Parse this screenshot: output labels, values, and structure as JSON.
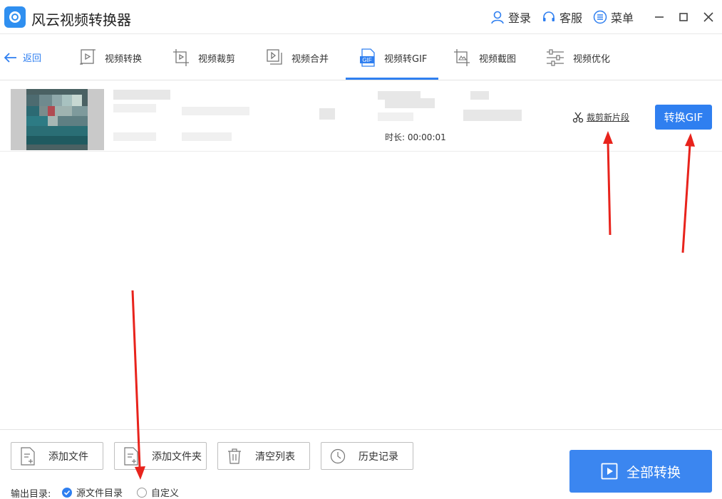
{
  "app": {
    "title": "风云视频转换器",
    "login": "登录",
    "service": "客服",
    "menu": "菜单"
  },
  "nav": {
    "back": "返回",
    "tabs": [
      {
        "label": "视频转换",
        "icon": "video-convert-icon"
      },
      {
        "label": "视频裁剪",
        "icon": "video-crop-icon"
      },
      {
        "label": "视频合并",
        "icon": "video-merge-icon"
      },
      {
        "label": "视频转GIF",
        "icon": "gif-icon",
        "active": true
      },
      {
        "label": "视频截图",
        "icon": "screenshot-icon"
      },
      {
        "label": "视频优化",
        "icon": "optimize-icon"
      }
    ]
  },
  "file": {
    "duration_label": "时长: 00:00:01",
    "clip_link": "裁剪新片段",
    "convert_button": "转换GIF"
  },
  "toolbar": {
    "add_file": "添加文件",
    "add_folder": "添加文件夹",
    "clear_list": "清空列表",
    "history": "历史记录"
  },
  "output": {
    "label": "输出目录:",
    "options": [
      {
        "label": "源文件目录",
        "checked": true
      },
      {
        "label": "自定义",
        "checked": false
      }
    ]
  },
  "convert_all": "全部转换",
  "colors": {
    "accent": "#2f7ff0",
    "annotation_arrow": "#e8231c"
  }
}
